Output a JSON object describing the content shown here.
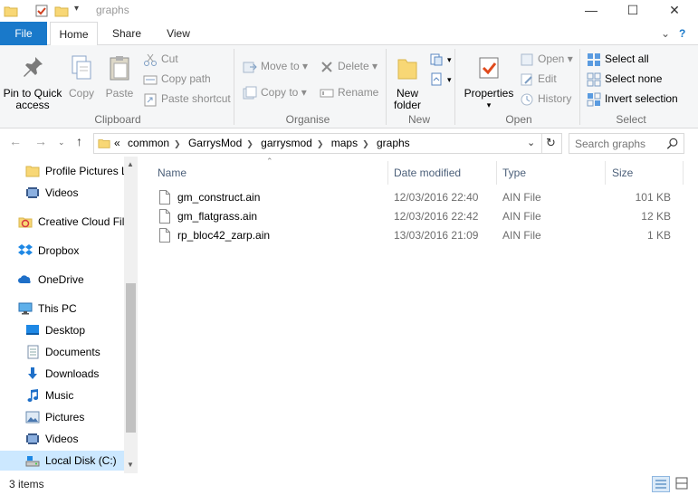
{
  "window": {
    "title": "graphs",
    "minimize": "—",
    "maximize": "☐",
    "close": "✕"
  },
  "tabs": {
    "file": "File",
    "home": "Home",
    "share": "Share",
    "view": "View"
  },
  "ribbon": {
    "clipboard": {
      "pin": "Pin to Quick access",
      "copy": "Copy",
      "paste": "Paste",
      "cut": "Cut",
      "copy_path": "Copy path",
      "paste_shortcut": "Paste shortcut",
      "label": "Clipboard"
    },
    "organise": {
      "move_to": "Move to",
      "copy_to": "Copy to",
      "delete": "Delete",
      "rename": "Rename",
      "label": "Organise"
    },
    "new": {
      "new_folder": "New folder",
      "label": "New"
    },
    "open": {
      "properties": "Properties",
      "open": "Open",
      "edit": "Edit",
      "history": "History",
      "label": "Open"
    },
    "select": {
      "select_all": "Select all",
      "select_none": "Select none",
      "invert": "Invert selection",
      "label": "Select"
    }
  },
  "address": {
    "overflow": "«",
    "crumbs": [
      "common",
      "GarrysMod",
      "garrysmod",
      "maps",
      "graphs"
    ]
  },
  "search": {
    "placeholder": "Search graphs"
  },
  "nav": {
    "items": [
      {
        "label": "Profile Pictures L",
        "icon": "folder-icon"
      },
      {
        "label": "Videos",
        "icon": "video-icon"
      },
      {
        "label": "Creative Cloud Fil",
        "icon": "creative-cloud-icon"
      },
      {
        "label": "Dropbox",
        "icon": "dropbox-icon"
      },
      {
        "label": "OneDrive",
        "icon": "onedrive-icon"
      },
      {
        "label": "This PC",
        "icon": "computer-icon"
      },
      {
        "label": "Desktop",
        "icon": "desktop-icon"
      },
      {
        "label": "Documents",
        "icon": "documents-icon"
      },
      {
        "label": "Downloads",
        "icon": "downloads-icon"
      },
      {
        "label": "Music",
        "icon": "music-icon"
      },
      {
        "label": "Pictures",
        "icon": "pictures-icon"
      },
      {
        "label": "Videos",
        "icon": "video-icon"
      },
      {
        "label": "Local Disk (C:)",
        "icon": "disk-icon"
      }
    ]
  },
  "columns": {
    "name": "Name",
    "date": "Date modified",
    "type": "Type",
    "size": "Size"
  },
  "files": [
    {
      "name": "gm_construct.ain",
      "date": "12/03/2016 22:40",
      "type": "AIN File",
      "size": "101 KB"
    },
    {
      "name": "gm_flatgrass.ain",
      "date": "12/03/2016 22:42",
      "type": "AIN File",
      "size": "12 KB"
    },
    {
      "name": "rp_bloc42_zarp.ain",
      "date": "13/03/2016 21:09",
      "type": "AIN File",
      "size": "1 KB"
    }
  ],
  "status": {
    "count": "3 items"
  },
  "colors": {
    "accent": "#1979ca",
    "selection": "#cce8ff",
    "folder": "#f8d775"
  }
}
